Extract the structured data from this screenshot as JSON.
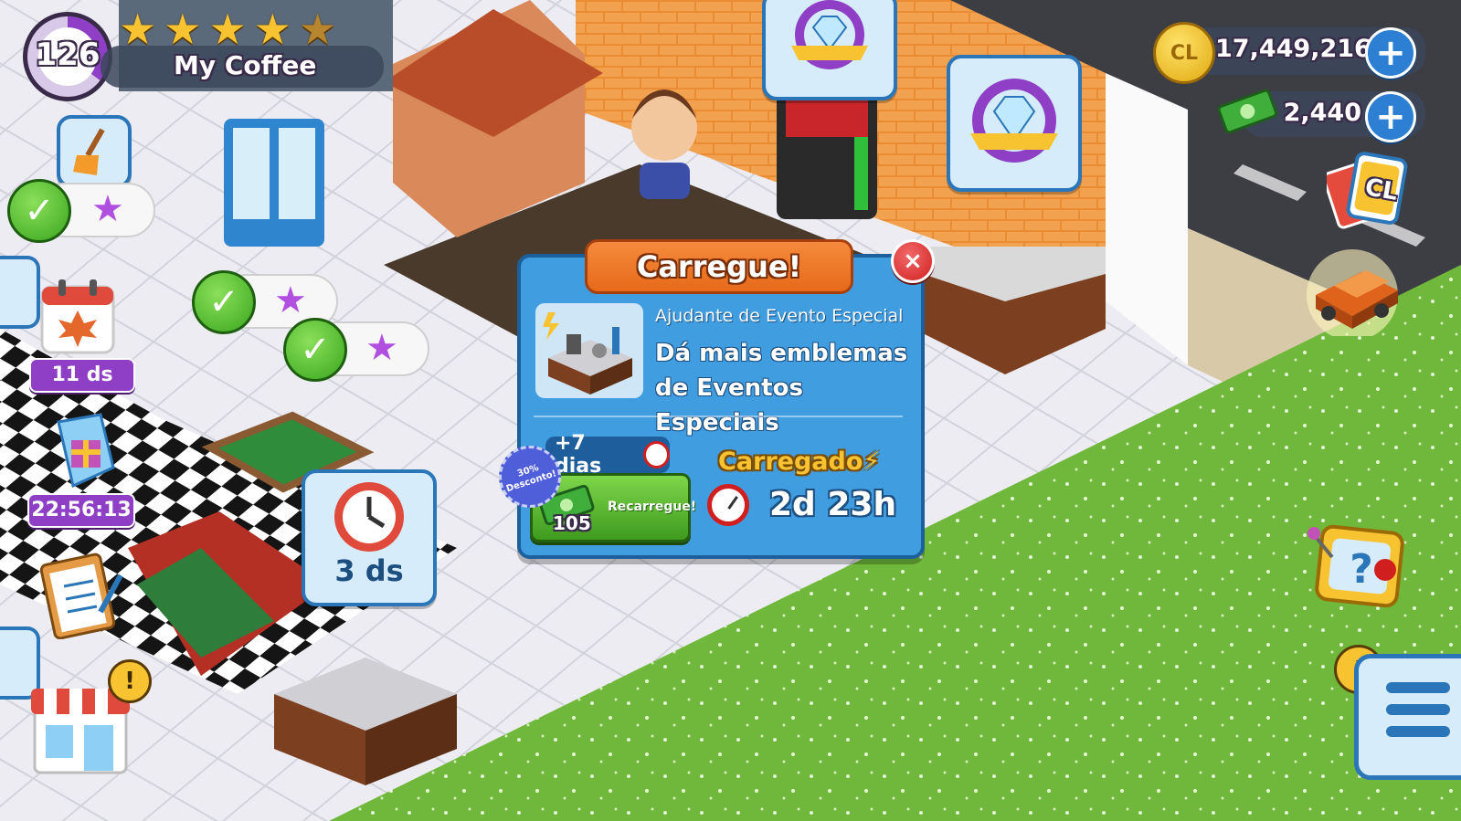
{
  "hud": {
    "level": "126",
    "level_progress": 0.35,
    "cafe_name": "My Coffee",
    "stars_total": 5,
    "stars_filled": 4,
    "coins": "17,449,216",
    "cash": "2,440",
    "coin_symbol": "CL",
    "cards_symbol": "CL"
  },
  "left_panel": {
    "calendar_timer": "11 ds",
    "gift_timer": "22:56:13"
  },
  "bubble": {
    "timer_label": "3 ds"
  },
  "popup": {
    "title": "Carregue!",
    "close_glyph": "×",
    "helper_name": "Ajudante de Evento Especial",
    "description_line1": "Dá mais emblemas",
    "description_line2": "de Eventos Especiais",
    "plus_days": "+7 dias",
    "discount_line1": "30%",
    "discount_line2": "Desconto!",
    "recharge_price": "105",
    "recharge_label": "Recarregue!",
    "charged_label": "Carregado",
    "remaining_time": "2d 23h"
  },
  "colors": {
    "popup_blue": "#3f9de0",
    "title_orange": "#f07a2c",
    "close_red": "#d11f1f",
    "recharge_green": "#4aa928",
    "charged_yellow": "#f7c331",
    "grass_green": "#6fb83b",
    "timer_purple": "#8e3fc6"
  },
  "icons": [
    "broom-icon",
    "check-icon",
    "star-icon",
    "calendar-maple-icon",
    "gift-tag-icon",
    "clipboard-icon",
    "shop-icon",
    "alert-icon",
    "diamond-badge-icon",
    "clock-icon",
    "coin-icon",
    "cash-icon",
    "plus-icon",
    "cards-icon",
    "delivery-truck-icon",
    "help-icon",
    "menu-icon",
    "lightning-icon",
    "stopwatch-icon"
  ]
}
